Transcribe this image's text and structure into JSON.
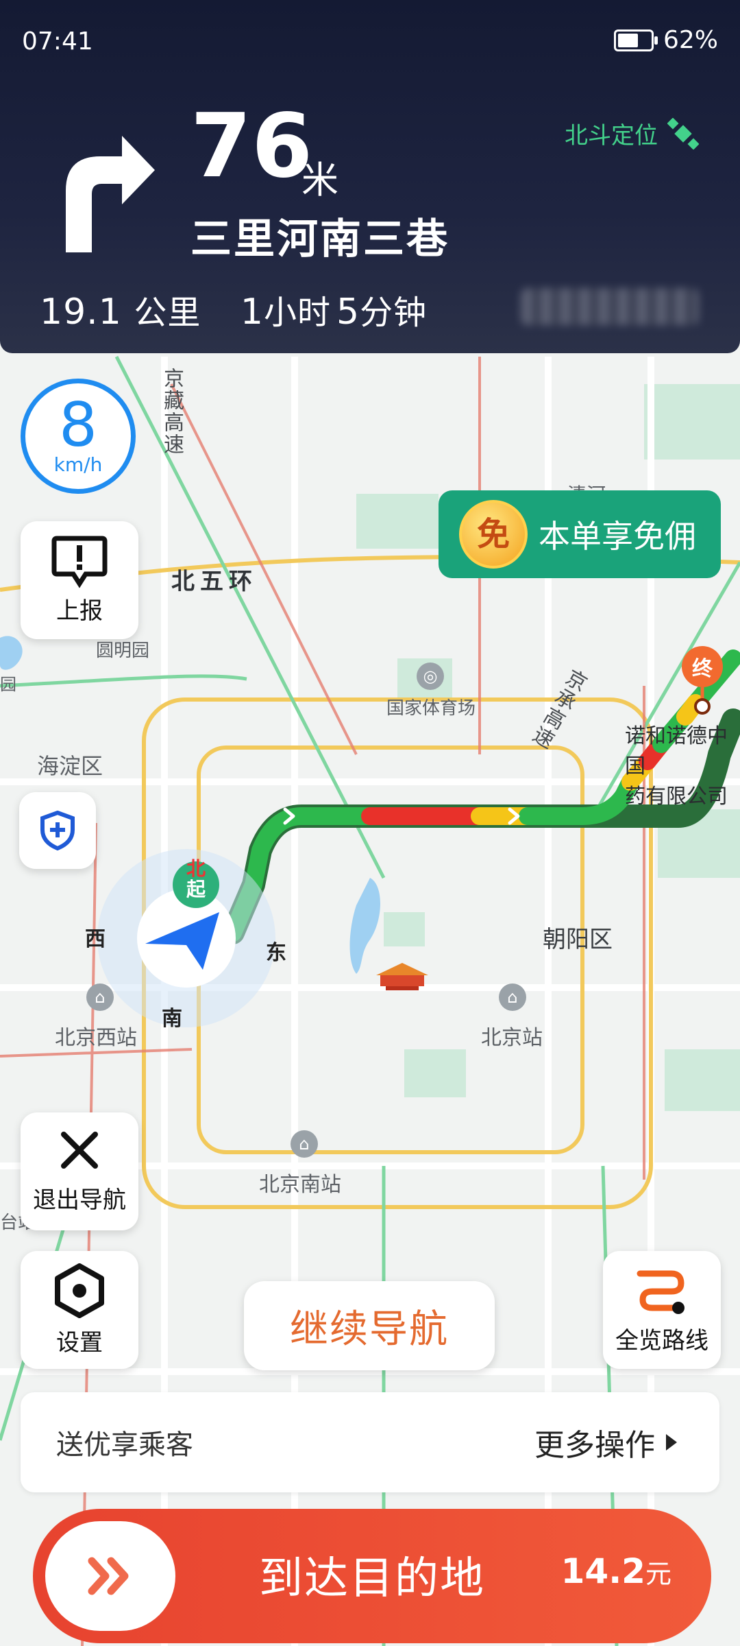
{
  "status_bar": {
    "time": "07:41",
    "battery": "62%",
    "battery_level": 0.62
  },
  "navigation": {
    "next_distance": "76",
    "next_distance_unit": "米",
    "next_street": "三里河南三巷",
    "positioning": "北斗定位",
    "remaining_distance": "19.1",
    "remaining_distance_unit": "公里",
    "remaining_time_hours": "1",
    "remaining_time_hours_unit": "小时",
    "remaining_time_minutes": "5",
    "remaining_time_minutes_unit": "分钟"
  },
  "speed": {
    "value": "8",
    "unit": "km/h"
  },
  "controls": {
    "report_label": "上报",
    "exit_label": "退出导航",
    "settings_label": "设置",
    "overview_label": "全览路线",
    "continue_label": "继续导航"
  },
  "promo": {
    "icon_text": "免",
    "label": "本单享免佣"
  },
  "map_labels": {
    "ring_road": "北五环",
    "jingzang": "京藏高速",
    "jingcheng": "京承高速",
    "qinghe": "清河",
    "yuanmingyuan": "圆明园",
    "haidian": "海淀区",
    "stadium": "国家体育场",
    "chaoyang": "朝阳区",
    "west_station": "北京西站",
    "beijing_station": "北京站",
    "south_station": "北京南站",
    "dest_name_line1": "诺和诺德中国",
    "dest_name_line2": "药有限公司",
    "compass_n": "北",
    "compass_s": "南",
    "compass_e": "东",
    "compass_w": "西",
    "start_marker": "起",
    "end_marker": "终",
    "edge_label_1": "园",
    "edge_label_2": "台站"
  },
  "action_bar": {
    "left_label": "送优享乘客",
    "right_label": "更多操作"
  },
  "arrive": {
    "label": "到达目的地",
    "price": "14.2",
    "price_unit": "元"
  },
  "colors": {
    "header_bg": "#1b2139",
    "accent_blue": "#1f8cf0",
    "route_green": "#2db84d",
    "route_red": "#e8312a",
    "route_yellow": "#f5c518",
    "promo_green": "#1aa37a",
    "arrive_red": "#ea4631",
    "continue_orange": "#e46a2f"
  }
}
